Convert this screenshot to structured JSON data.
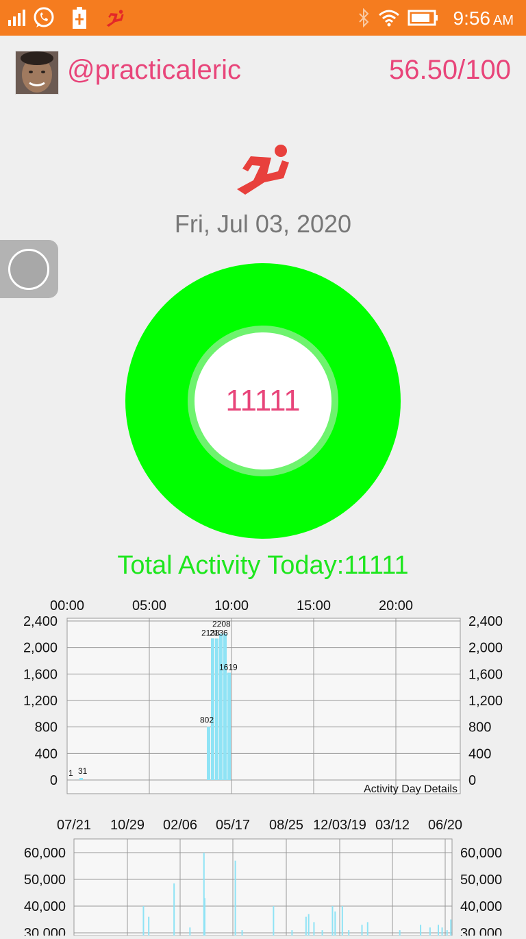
{
  "status_bar": {
    "time": "9:56",
    "ampm": "AM",
    "icons": [
      "signal-icon",
      "whatsapp-icon",
      "battery-charging-icon",
      "runner-icon",
      "bluetooth-icon",
      "wifi-icon",
      "battery-icon"
    ]
  },
  "profile": {
    "username": "@practicaleric",
    "score": "56.50/100"
  },
  "date": "Fri, Jul 03, 2020",
  "ring": {
    "value": "11111",
    "progress": 1.0,
    "color": "#00ff00"
  },
  "total_label": "Total Activity Today:11111",
  "colors": {
    "accent": "#e8457a",
    "status_bar": "#f57c1f",
    "ring": "#00ff00",
    "total_text": "#1ee61e",
    "bar": "#8fe3f5"
  },
  "chart_data": [
    {
      "type": "bar",
      "title": "Activity Day Details",
      "x_ticks": [
        "00:00",
        "05:00",
        "10:00",
        "15:00",
        "20:00"
      ],
      "x_tick_hours": [
        0,
        5,
        10,
        15,
        20
      ],
      "xlim": [
        0,
        24
      ],
      "ylim": [
        0,
        2400
      ],
      "y_ticks": [
        "2,400",
        "2,000",
        "1,600",
        "1,200",
        "800",
        "400",
        "0"
      ],
      "y_tick_values": [
        2400,
        2000,
        1600,
        1200,
        800,
        400,
        0
      ],
      "grid": true,
      "bars": [
        {
          "hour": 0.25,
          "value": 1,
          "label": "1"
        },
        {
          "hour": 0.75,
          "value": 31,
          "label": "31"
        },
        {
          "hour": 8.5,
          "value": 802,
          "label": "802"
        },
        {
          "hour": 8.75,
          "value": 2138,
          "label": "2138"
        },
        {
          "hour": 9.0,
          "value": 2136,
          "label": "2136"
        },
        {
          "hour": 9.25,
          "value": 2208,
          "label": "2208"
        },
        {
          "hour": 9.5,
          "value": 2207,
          "label": "2207"
        },
        {
          "hour": 9.75,
          "value": 1619,
          "label": "1619"
        }
      ]
    },
    {
      "type": "bar",
      "title": "",
      "x_ticks": [
        "07/21",
        "10/29",
        "02/06",
        "05/17",
        "08/25",
        "12/03/19",
        "03/12",
        "06/20"
      ],
      "ylim": [
        30000,
        62000
      ],
      "y_ticks": [
        "60,000",
        "50,000",
        "40,000",
        "30,000"
      ],
      "y_tick_values": [
        60000,
        50000,
        40000,
        30000
      ],
      "grid": true,
      "bar_positions": [
        0.182,
        0.196,
        0.263,
        0.305,
        0.342,
        0.344,
        0.425,
        0.443,
        0.526,
        0.575,
        0.612,
        0.619,
        0.633,
        0.655,
        0.682,
        0.689,
        0.708,
        0.725,
        0.76,
        0.775,
        0.86,
        0.915,
        0.94,
        0.962,
        0.972,
        0.985,
        0.995
      ],
      "values": [
        40000,
        36000,
        48500,
        32000,
        60000,
        43000,
        57000,
        31000,
        40000,
        31000,
        36000,
        37000,
        34000,
        31000,
        40000,
        38000,
        40000,
        31000,
        33000,
        34000,
        31000,
        33000,
        32000,
        33000,
        32000,
        31000,
        35000
      ]
    }
  ]
}
